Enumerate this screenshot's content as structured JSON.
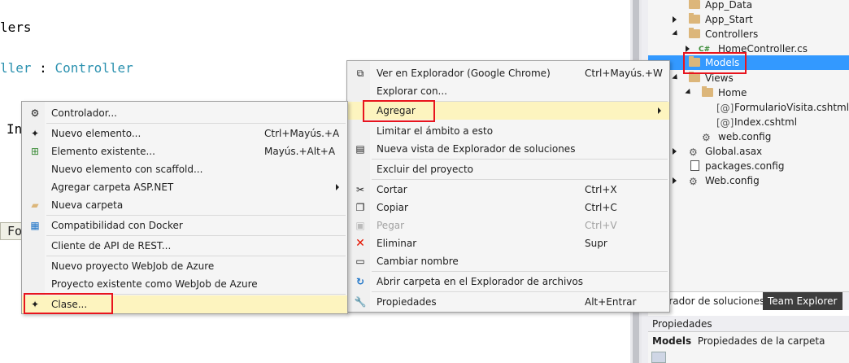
{
  "editor": {
    "line1": "lers",
    "line2_a": "ller",
    "line2_b": " : ",
    "line2_c": "Controller",
    "line3": "In",
    "fo_box": "Fo"
  },
  "solution_explorer": {
    "items": [
      {
        "label": "App_Data"
      },
      {
        "label": "App_Start"
      },
      {
        "label": "Controllers"
      },
      {
        "label": "HomeController.cs"
      },
      {
        "label": "Models"
      },
      {
        "label": "Views"
      },
      {
        "label": "Home"
      },
      {
        "label": "FormularioVisita.cshtml"
      },
      {
        "label": "Index.cshtml"
      },
      {
        "label": "web.config"
      },
      {
        "label": "Global.asax"
      },
      {
        "label": "packages.config"
      },
      {
        "label": "Web.config"
      }
    ],
    "tabs": {
      "solution": "orador de soluciones",
      "team": "Team Explorer"
    }
  },
  "properties": {
    "title": "Propiedades",
    "object_name": "Models",
    "object_desc": "Propiedades de la carpeta"
  },
  "main_menu": {
    "items": [
      {
        "label": "Ver en Explorador (Google Chrome)",
        "shortcut": "Ctrl+Mayús.+W"
      },
      {
        "label": "Explorar con..."
      },
      {
        "label": "Agregar"
      },
      {
        "label": "Limitar el ámbito a esto"
      },
      {
        "label": "Nueva vista de Explorador de soluciones"
      },
      {
        "label": "Excluir del proyecto"
      },
      {
        "label": "Cortar",
        "shortcut": "Ctrl+X"
      },
      {
        "label": "Copiar",
        "shortcut": "Ctrl+C"
      },
      {
        "label": "Pegar",
        "shortcut": "Ctrl+V"
      },
      {
        "label": "Eliminar",
        "shortcut": "Supr"
      },
      {
        "label": "Cambiar nombre"
      },
      {
        "label": "Abrir carpeta en el Explorador de archivos"
      },
      {
        "label": "Propiedades",
        "shortcut": "Alt+Entrar"
      }
    ]
  },
  "sub_menu": {
    "items": [
      {
        "label": "Controlador..."
      },
      {
        "label": "Nuevo elemento...",
        "shortcut": "Ctrl+Mayús.+A"
      },
      {
        "label": "Elemento existente...",
        "shortcut": "Mayús.+Alt+A"
      },
      {
        "label": "Nuevo elemento con scaffold..."
      },
      {
        "label": "Agregar carpeta ASP.NET"
      },
      {
        "label": "Nueva carpeta"
      },
      {
        "label": "Compatibilidad con Docker"
      },
      {
        "label": "Cliente de API de REST..."
      },
      {
        "label": "Nuevo proyecto WebJob de Azure"
      },
      {
        "label": "Proyecto existente como WebJob de Azure"
      },
      {
        "label": "Clase..."
      }
    ]
  },
  "colors": {
    "selection": "#3399ff",
    "menu_highlight": "#fdf4bf",
    "annotation_red": "#e8141e",
    "type_color": "#2b91af"
  }
}
